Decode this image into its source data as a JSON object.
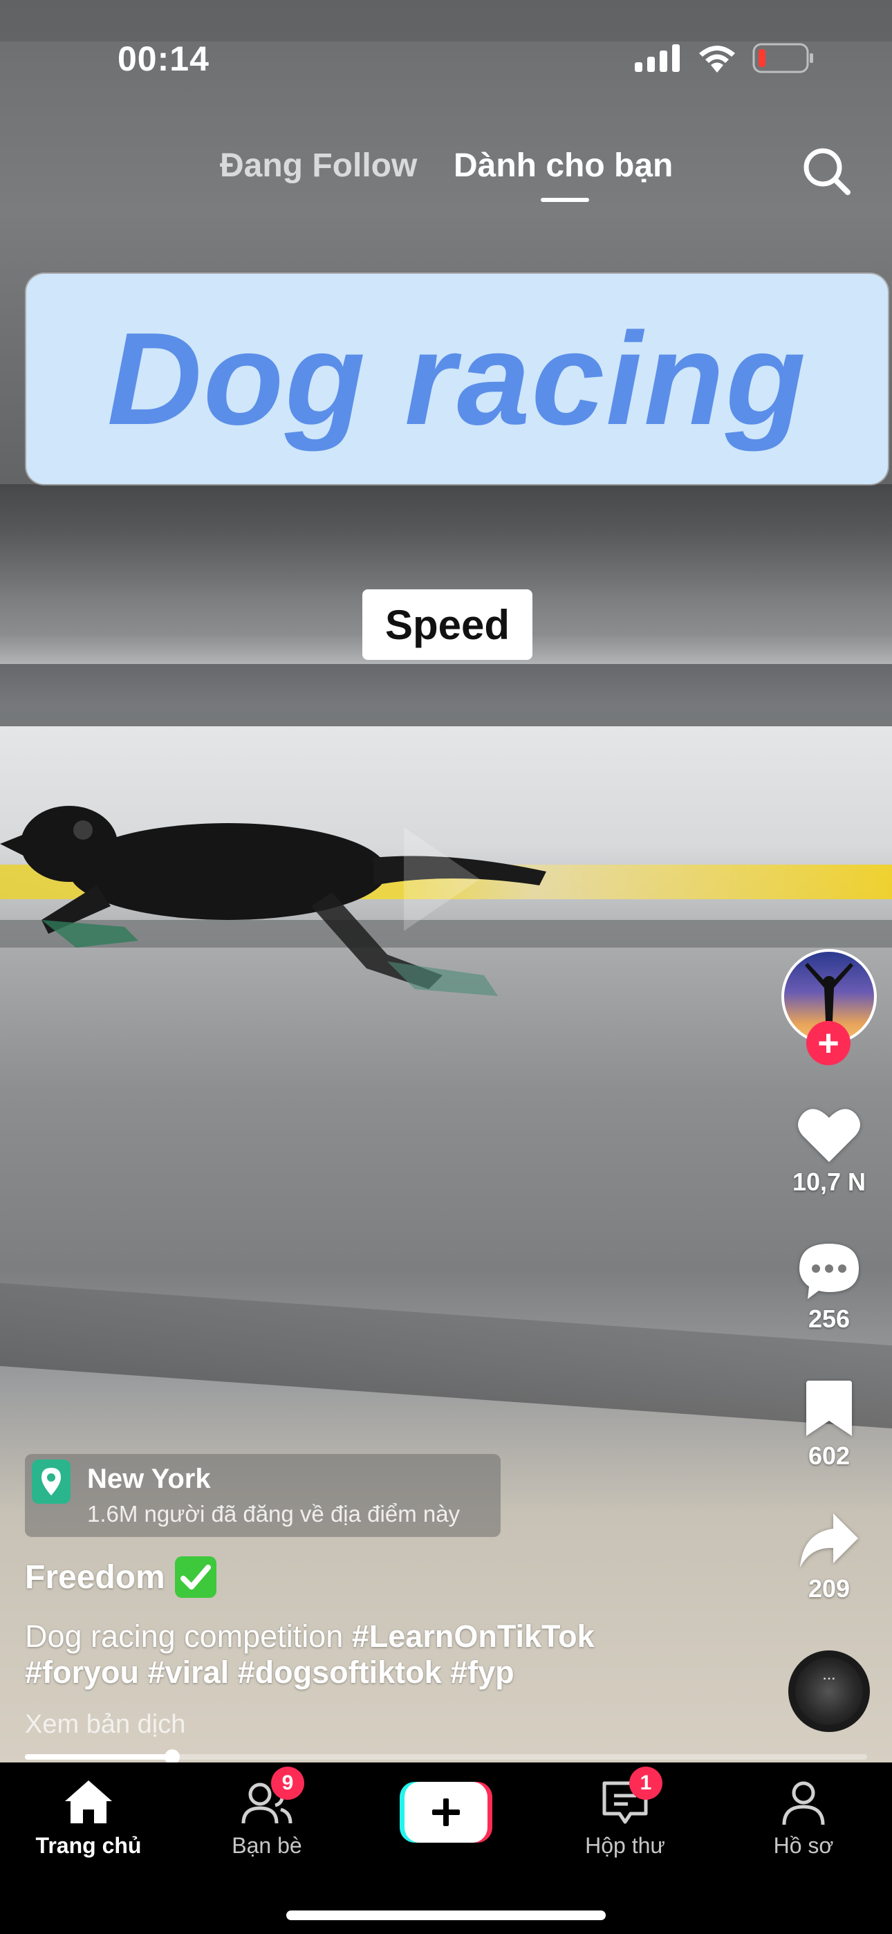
{
  "status_bar": {
    "time": "00:14"
  },
  "top_tabs": {
    "following": "Đang Follow",
    "for_you": "Dành cho bạn",
    "active": "for_you"
  },
  "overlay": {
    "title": "Dog racing",
    "tag": "Speed"
  },
  "actions": {
    "likes": "10,7 N",
    "comments": "256",
    "saves": "602",
    "shares": "209"
  },
  "location": {
    "name": "New York",
    "subtitle": "1.6M người đã đăng về địa điểm này"
  },
  "author": {
    "name": "Freedom",
    "badge_icon": "check-box-emoji"
  },
  "caption": {
    "text": "Dog racing competition",
    "hashtags_line1": "#LearnOnTikTok",
    "hashtags_line2": "#foryou #viral #dogsoftiktok #fyp"
  },
  "translate_link": "Xem bản dịch",
  "playback": {
    "progress": 0.175
  },
  "nav": {
    "home": "Trang chủ",
    "friends": "Bạn bè",
    "friends_badge": "9",
    "inbox": "Hộp thư",
    "inbox_badge": "1",
    "profile": "Hồ sơ",
    "active": "home"
  },
  "colors": {
    "accent": "#fe2c55",
    "title_card_bg": "#cfe6fb",
    "title_text": "#5b8ee8",
    "location_icon": "#2bb58c"
  }
}
